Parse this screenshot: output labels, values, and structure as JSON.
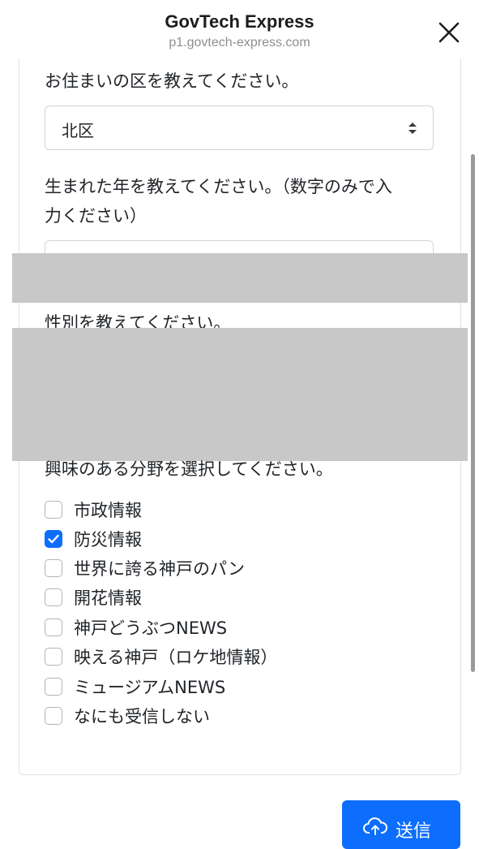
{
  "header": {
    "title": "GovTech Express",
    "url": "p1.govtech-express.com"
  },
  "form": {
    "ward_question": "お住まいの区を教えてください。",
    "ward_value": "北区",
    "birth_year_question_line1": "生まれた年を教えてください。（数字のみで入",
    "birth_year_question_line2": "力ください）",
    "gender_question": "性別を教えてください。",
    "interest_question": "興味のある分野を選択してください。",
    "interests": [
      {
        "label": "市政情報",
        "checked": false
      },
      {
        "label": "防災情報",
        "checked": true
      },
      {
        "label": "世界に誇る神戸のパン",
        "checked": false
      },
      {
        "label": "開花情報",
        "checked": false
      },
      {
        "label": "神戸どうぶつNEWS",
        "checked": false
      },
      {
        "label": "映える神戸（ロケ地情報）",
        "checked": false
      },
      {
        "label": "ミュージアムNEWS",
        "checked": false
      },
      {
        "label": "なにも受信しない",
        "checked": false
      }
    ],
    "submit_label": "送信"
  },
  "colors": {
    "accent": "#0d6efd",
    "redaction": "#c8c8c8",
    "border": "#ced4da"
  }
}
